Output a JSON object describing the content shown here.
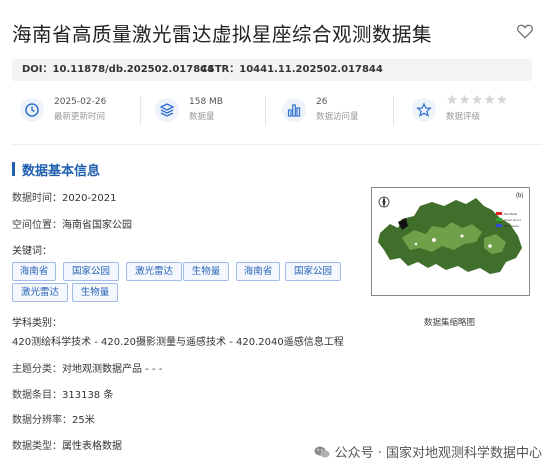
{
  "header": {
    "title": "海南省高质量激光雷达虚拟星座综合观测数据集",
    "favorite_icon": "heart-icon"
  },
  "identifiers": {
    "doi": "DOI：10.11878/db.202502.017844",
    "cstr": "CSTR：10441.11.202502.017844"
  },
  "stats": [
    {
      "icon": "clock-icon",
      "value": "2025-02-26",
      "label": "最新更新时间"
    },
    {
      "icon": "layers-icon",
      "value": "158 MB",
      "label": "数据量"
    },
    {
      "icon": "bar-chart-icon",
      "value": "26",
      "label": "数据访问量"
    },
    {
      "icon": "star-icon",
      "value": "",
      "label": "数据评级",
      "rating": 0,
      "rating_max": 5
    }
  ],
  "section": {
    "title": "数据基本信息"
  },
  "info": {
    "time_label": "数据时间：",
    "time_value": "2020-2021",
    "location_label": "空间位置：",
    "location_value": "海南省国家公园",
    "keywords_label": "关键词：",
    "keywords": [
      "海南省",
      "国家公园",
      "激光雷达",
      "生物量",
      "海南省",
      "国家公园",
      "激光雷达",
      "生物量"
    ],
    "subject_label": "学科类别：",
    "subject_value": "420测绘科学技术 - 420.20摄影测量与遥感技术 - 420.2040遥感信息工程",
    "theme_label": "主题分类：",
    "theme_value": "对地观测数据产品 - - -",
    "records_label": "数据条目：",
    "records_value": "313138 条",
    "resolution_label": "数据分辨率：",
    "resolution_value": "25米",
    "type_label": "数据类型：",
    "type_value": "属性表格数据"
  },
  "thumbnail": {
    "caption": "数据集缩略图",
    "corner_label": "(b)",
    "legend": [
      {
        "color": "#e02020",
        "text": "Test   Build"
      },
      {
        "color": "#2ea82e",
        "text": "Green  Sum t"
      },
      {
        "color": "#3048d8",
        "text": "Blue   Grass"
      }
    ]
  },
  "watermark": {
    "text": "公众号 · 国家对地观测科学数据中心"
  }
}
